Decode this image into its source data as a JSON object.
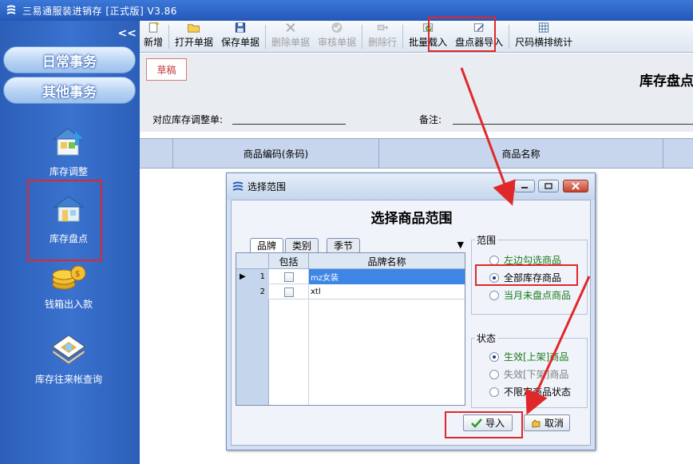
{
  "app": {
    "title": "三易通服装进销存 [正式版] V3.86"
  },
  "sidebar": {
    "collapse": "<<",
    "nav": [
      "日常事务",
      "其他事务"
    ],
    "modules": [
      "库存调整",
      "库存盘点",
      "钱箱出入款",
      "库存往来帐查询"
    ]
  },
  "toolbar": {
    "items": [
      {
        "label": "新增",
        "icon": "new-icon",
        "enabled": true
      },
      {
        "label": "打开单据",
        "icon": "folder-open-icon",
        "enabled": true
      },
      {
        "label": "保存单据",
        "icon": "save-icon",
        "enabled": true
      },
      {
        "label": "删除单据",
        "icon": "delete-icon",
        "enabled": false
      },
      {
        "label": "审核单据",
        "icon": "check-icon",
        "enabled": false
      },
      {
        "label": "删除行",
        "icon": "delete-row-icon",
        "enabled": false
      },
      {
        "label": "批量载入",
        "icon": "batch-load-icon",
        "enabled": true
      },
      {
        "label": "盘点器导入",
        "icon": "scanner-import-icon",
        "enabled": true
      },
      {
        "label": "尺码横排统计",
        "icon": "size-stats-icon",
        "enabled": true
      }
    ]
  },
  "document": {
    "status": "草稿",
    "title": "库存盘点",
    "adjust_label": "对应库存调整单:",
    "remark_label": "备注:",
    "columns": [
      "商品编码(条码)",
      "商品名称"
    ]
  },
  "dialog": {
    "window_title": "选择范围",
    "heading": "选择商品范围",
    "tabs": [
      "品牌",
      "类别",
      "季节"
    ],
    "table_headers": [
      "包括",
      "品牌名称"
    ],
    "rows": [
      {
        "no": "1",
        "name": "mz女装",
        "selected": true
      },
      {
        "no": "2",
        "name": "xtl",
        "selected": false
      }
    ],
    "scope_group": "范围",
    "scope_options": [
      "左边勾选商品",
      "全部库存商品",
      "当月未盘点商品"
    ],
    "scope_selected": 1,
    "status_group": "状态",
    "status_options": [
      "生效[上架]商品",
      "失效[下架]商品",
      "不限定商品状态"
    ],
    "status_selected": 0,
    "import_label": "导入",
    "cancel_label": "取消"
  },
  "colors": {
    "highlight": "#e0282a",
    "sidebar": "#2c5fb8",
    "selection": "#3d86e6"
  }
}
